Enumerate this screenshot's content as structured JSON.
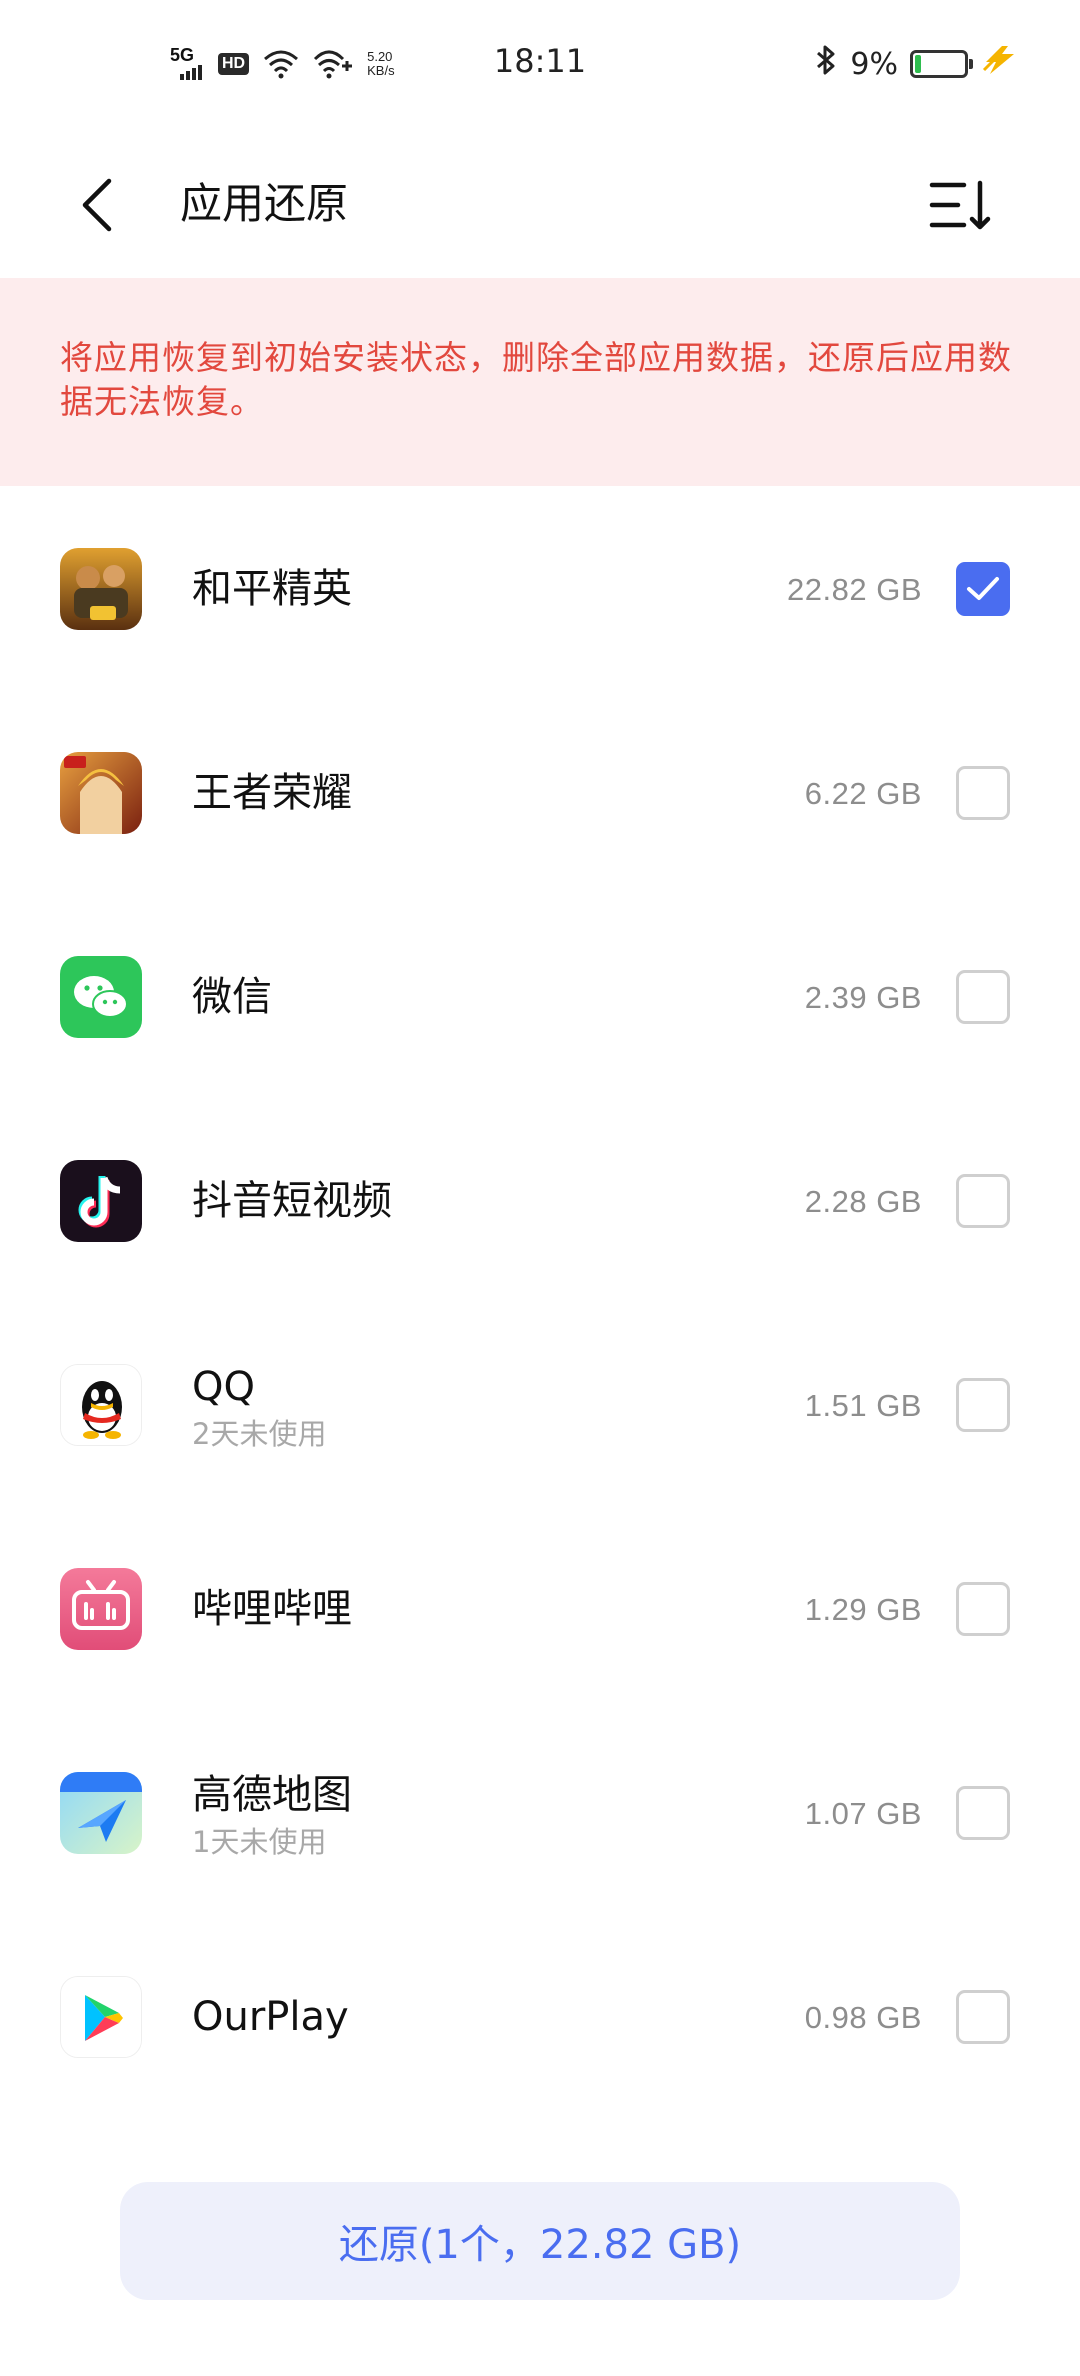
{
  "status_bar": {
    "network": "5G",
    "hd": "HD",
    "speed_value": "5.20",
    "speed_unit": "KB/s",
    "time": "18:11",
    "battery_pct": "9%"
  },
  "header": {
    "title": "应用还原"
  },
  "warning": {
    "text": "将应用恢复到初始安装状态，删除全部应用数据，还原后应用数据无法恢复。"
  },
  "apps": [
    {
      "name": "和平精英",
      "sub": "",
      "size": "22.82 GB",
      "checked": true,
      "icon": "pubg-icon"
    },
    {
      "name": "王者荣耀",
      "sub": "",
      "size": "6.22 GB",
      "checked": false,
      "icon": "honor-of-kings-icon"
    },
    {
      "name": "微信",
      "sub": "",
      "size": "2.39 GB",
      "checked": false,
      "icon": "wechat-icon"
    },
    {
      "name": "抖音短视频",
      "sub": "",
      "size": "2.28 GB",
      "checked": false,
      "icon": "douyin-icon"
    },
    {
      "name": "QQ",
      "sub": "2天未使用",
      "size": "1.51 GB",
      "checked": false,
      "icon": "qq-icon"
    },
    {
      "name": "哔哩哔哩",
      "sub": "",
      "size": "1.29 GB",
      "checked": false,
      "icon": "bilibili-icon"
    },
    {
      "name": "高德地图",
      "sub": "1天未使用",
      "size": "1.07 GB",
      "checked": false,
      "icon": "amap-icon"
    },
    {
      "name": "OurPlay",
      "sub": "",
      "size": "0.98 GB",
      "checked": false,
      "icon": "ourplay-icon"
    }
  ],
  "restore_button": {
    "label": "还原(1个，22.82 GB)"
  },
  "colors": {
    "accent": "#4a6df0",
    "warning_text": "#e2483e",
    "warning_bg": "#fdeced"
  }
}
